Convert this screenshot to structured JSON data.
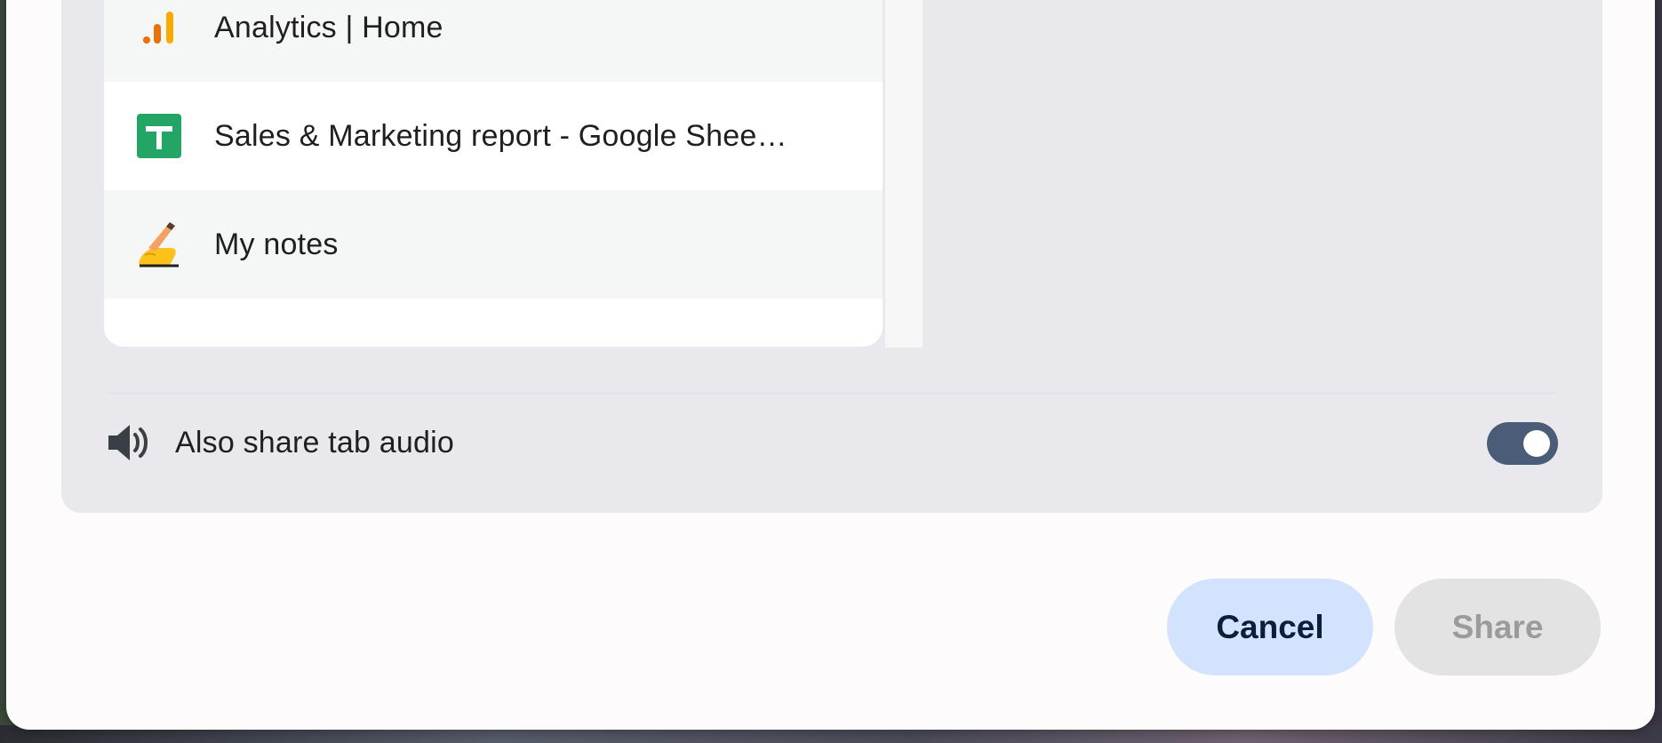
{
  "tabs": [
    {
      "title": "Analytics | Home",
      "icon": "analytics-icon"
    },
    {
      "title": "Sales & Marketing report - Google Shee…",
      "icon": "google-sheets-icon"
    },
    {
      "title": "My notes",
      "icon": "writing-hand-icon"
    }
  ],
  "audio": {
    "label": "Also share tab audio",
    "icon": "speaker-icon",
    "enabled": true
  },
  "buttons": {
    "cancel": "Cancel",
    "share": "Share"
  },
  "colors": {
    "toggle_on": "#4b5c78",
    "cancel_bg": "#d3e3fd",
    "share_disabled_bg": "#e3e3e3",
    "sheets_green": "#23a566",
    "analytics_orange": "#f9ab00"
  }
}
